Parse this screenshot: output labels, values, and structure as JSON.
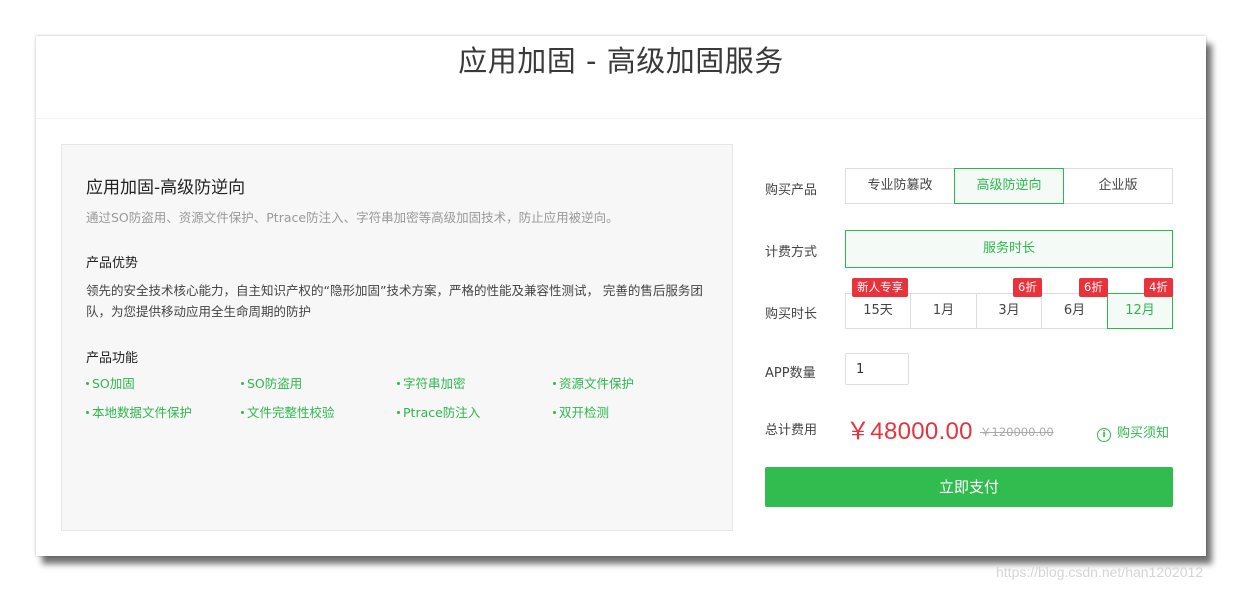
{
  "page_title": "应用加固 - 高级加固服务",
  "product": {
    "title": "应用加固-高级防逆向",
    "subtitle": "通过SO防盗用、资源文件保护、Ptrace防注入、字符串加密等高级加固技术，防止应用被逆向。",
    "advantage_heading": "产品优势",
    "advantage_text": "领先的安全技术核心能力，自主知识产权的“隐形加固”技术方案，严格的性能及兼容性测试， 完善的售后服务团队，为您提供移动应用全生命周期的防护",
    "function_heading": "产品功能",
    "features": [
      "SO加固",
      "SO防盗用",
      "字符串加密",
      "资源文件保护",
      "本地数据文件保护",
      "文件完整性校验",
      "Ptrace防注入",
      "双开检测"
    ]
  },
  "order": {
    "product_label": "购买产品",
    "products": [
      {
        "label": "专业防篡改",
        "active": false
      },
      {
        "label": "高级防逆向",
        "active": true
      },
      {
        "label": "企业版",
        "active": false
      }
    ],
    "billing_label": "计费方式",
    "billing_option": "服务时长",
    "duration_label": "购买时长",
    "durations": [
      {
        "label": "15天",
        "badge": "新人专享",
        "active": false
      },
      {
        "label": "1月",
        "badge": "",
        "active": false
      },
      {
        "label": "3月",
        "badge": "6折",
        "active": false
      },
      {
        "label": "6月",
        "badge": "6折",
        "active": false
      },
      {
        "label": "12月",
        "badge": "4折",
        "active": true
      }
    ],
    "qty_label": "APP数量",
    "qty_value": "1",
    "total_label": "总计费用",
    "price": "￥48000.00",
    "original_price": "￥120000.00",
    "notice": "购买须知",
    "pay_button": "立即支付"
  },
  "watermark": "https://blog.csdn.net/han1202012",
  "colors": {
    "accent": "#2db84d",
    "price": "#e8323c",
    "badge": "#e8323c",
    "pay_button": "#32bb4f"
  }
}
